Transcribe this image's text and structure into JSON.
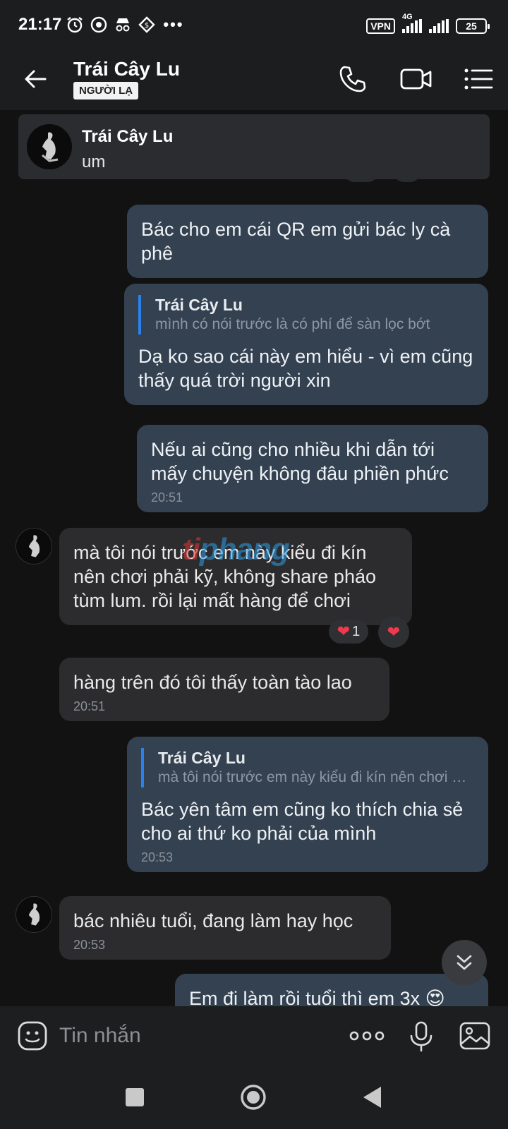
{
  "status_bar": {
    "time": "21:17",
    "dots": "•••",
    "vpn": "VPN",
    "network": "4G",
    "battery": "25"
  },
  "header": {
    "contact_name": "Trái Cây Lu",
    "badge": "NGƯỜI LẠ"
  },
  "pinned": {
    "name": "Trái Cây Lu",
    "text": "um"
  },
  "messages": [
    {
      "text": "Bác cho em cái QR em gửi bác ly cà phê"
    },
    {
      "quote_name": "Trái Cây Lu",
      "quote_text": "mình có nói trước là có phí để sàn lọc bớt",
      "text": "Dạ ko sao cái này em hiểu - vì em cũng thấy quá trời người xin"
    },
    {
      "text": "Nếu ai cũng cho nhiều khi dẫn tới mấy chuyện không đâu phiền phức",
      "time": "20:51"
    },
    {
      "text": "mà tôi nói trước em này kiểu đi kín nên chơi phải kỹ, không share pháo tùm lum. rồi lại mất hàng để chơi",
      "reaction_count": "1"
    },
    {
      "text": "hàng trên đó tôi thấy toàn tào lao",
      "time": "20:51"
    },
    {
      "quote_name": "Trái Cây Lu",
      "quote_text": "mà tôi nói trước em này kiểu đi kín nên chơi phải kỹ",
      "text": "Bác yên tâm em cũng ko thích chia sẻ cho ai thứ ko phải của mình",
      "time": "20:53"
    },
    {
      "text": "bác nhiêu tuổi, đang làm hay học",
      "time": "20:53"
    },
    {
      "text": "Em đi làm rồi tuổi thì em 3x 😍"
    }
  ],
  "watermark": {
    "part1": "ti",
    "part2": "phang"
  },
  "composer": {
    "placeholder": "Tin nhắn"
  },
  "colors": {
    "accent": "#2a82ef",
    "mine_bubble": "#344150",
    "theirs_bubble": "#2c2c2e",
    "heart": "#f0394b"
  }
}
